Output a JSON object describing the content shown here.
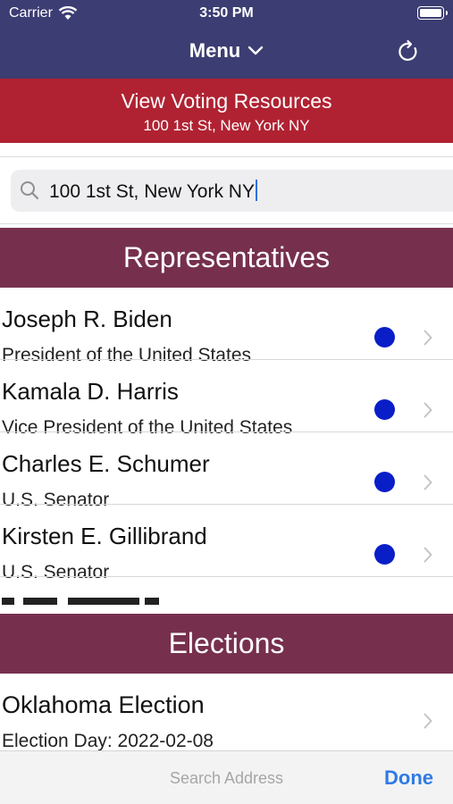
{
  "status_bar": {
    "carrier": "Carrier",
    "time": "3:50 PM"
  },
  "nav": {
    "menu_label": "Menu"
  },
  "voting_resources": {
    "title": "View Voting Resources",
    "address": "100 1st St, New York NY"
  },
  "search": {
    "value": "100 1st St, New York NY"
  },
  "representatives": {
    "header": "Representatives",
    "items": [
      {
        "name": "Joseph R. Biden",
        "office": "President of the United States",
        "party_color": "#0a1ec8"
      },
      {
        "name": "Kamala D. Harris",
        "office": "Vice President of the United States",
        "party_color": "#0a1ec8"
      },
      {
        "name": "Charles E. Schumer",
        "office": "U.S. Senator",
        "party_color": "#0a1ec8"
      },
      {
        "name": "Kirsten E. Gillibrand",
        "office": "U.S. Senator",
        "party_color": "#0a1ec8"
      }
    ]
  },
  "elections": {
    "header": "Elections",
    "items": [
      {
        "name": "Oklahoma Election",
        "day": "Election Day: 2022-02-08"
      }
    ]
  },
  "keyboard_toolbar": {
    "title": "Search Address",
    "done_label": "Done"
  },
  "colors": {
    "nav_bar": "#3c3d72",
    "resources_banner": "#b02232",
    "section_header": "#76304e",
    "accent": "#2f7ae5"
  }
}
